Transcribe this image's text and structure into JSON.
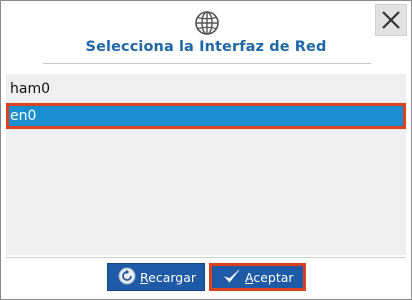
{
  "dialog": {
    "title": "Selecciona la Interfaz de Red",
    "header_icon": "globe-icon",
    "close_icon": "close-icon"
  },
  "interfaces": [
    {
      "label": "ham0",
      "selected": false
    },
    {
      "label": "en0",
      "selected": true
    }
  ],
  "buttons": {
    "reload_label": "Recargar",
    "reload_icon": "refresh-icon",
    "accept_label": "Aceptar",
    "accept_icon": "checkmark-icon"
  },
  "colors": {
    "title": "#1f68a8",
    "selection": "#1a8ed2",
    "highlight_border": "#d9421f",
    "button": "#1e5aa6"
  }
}
